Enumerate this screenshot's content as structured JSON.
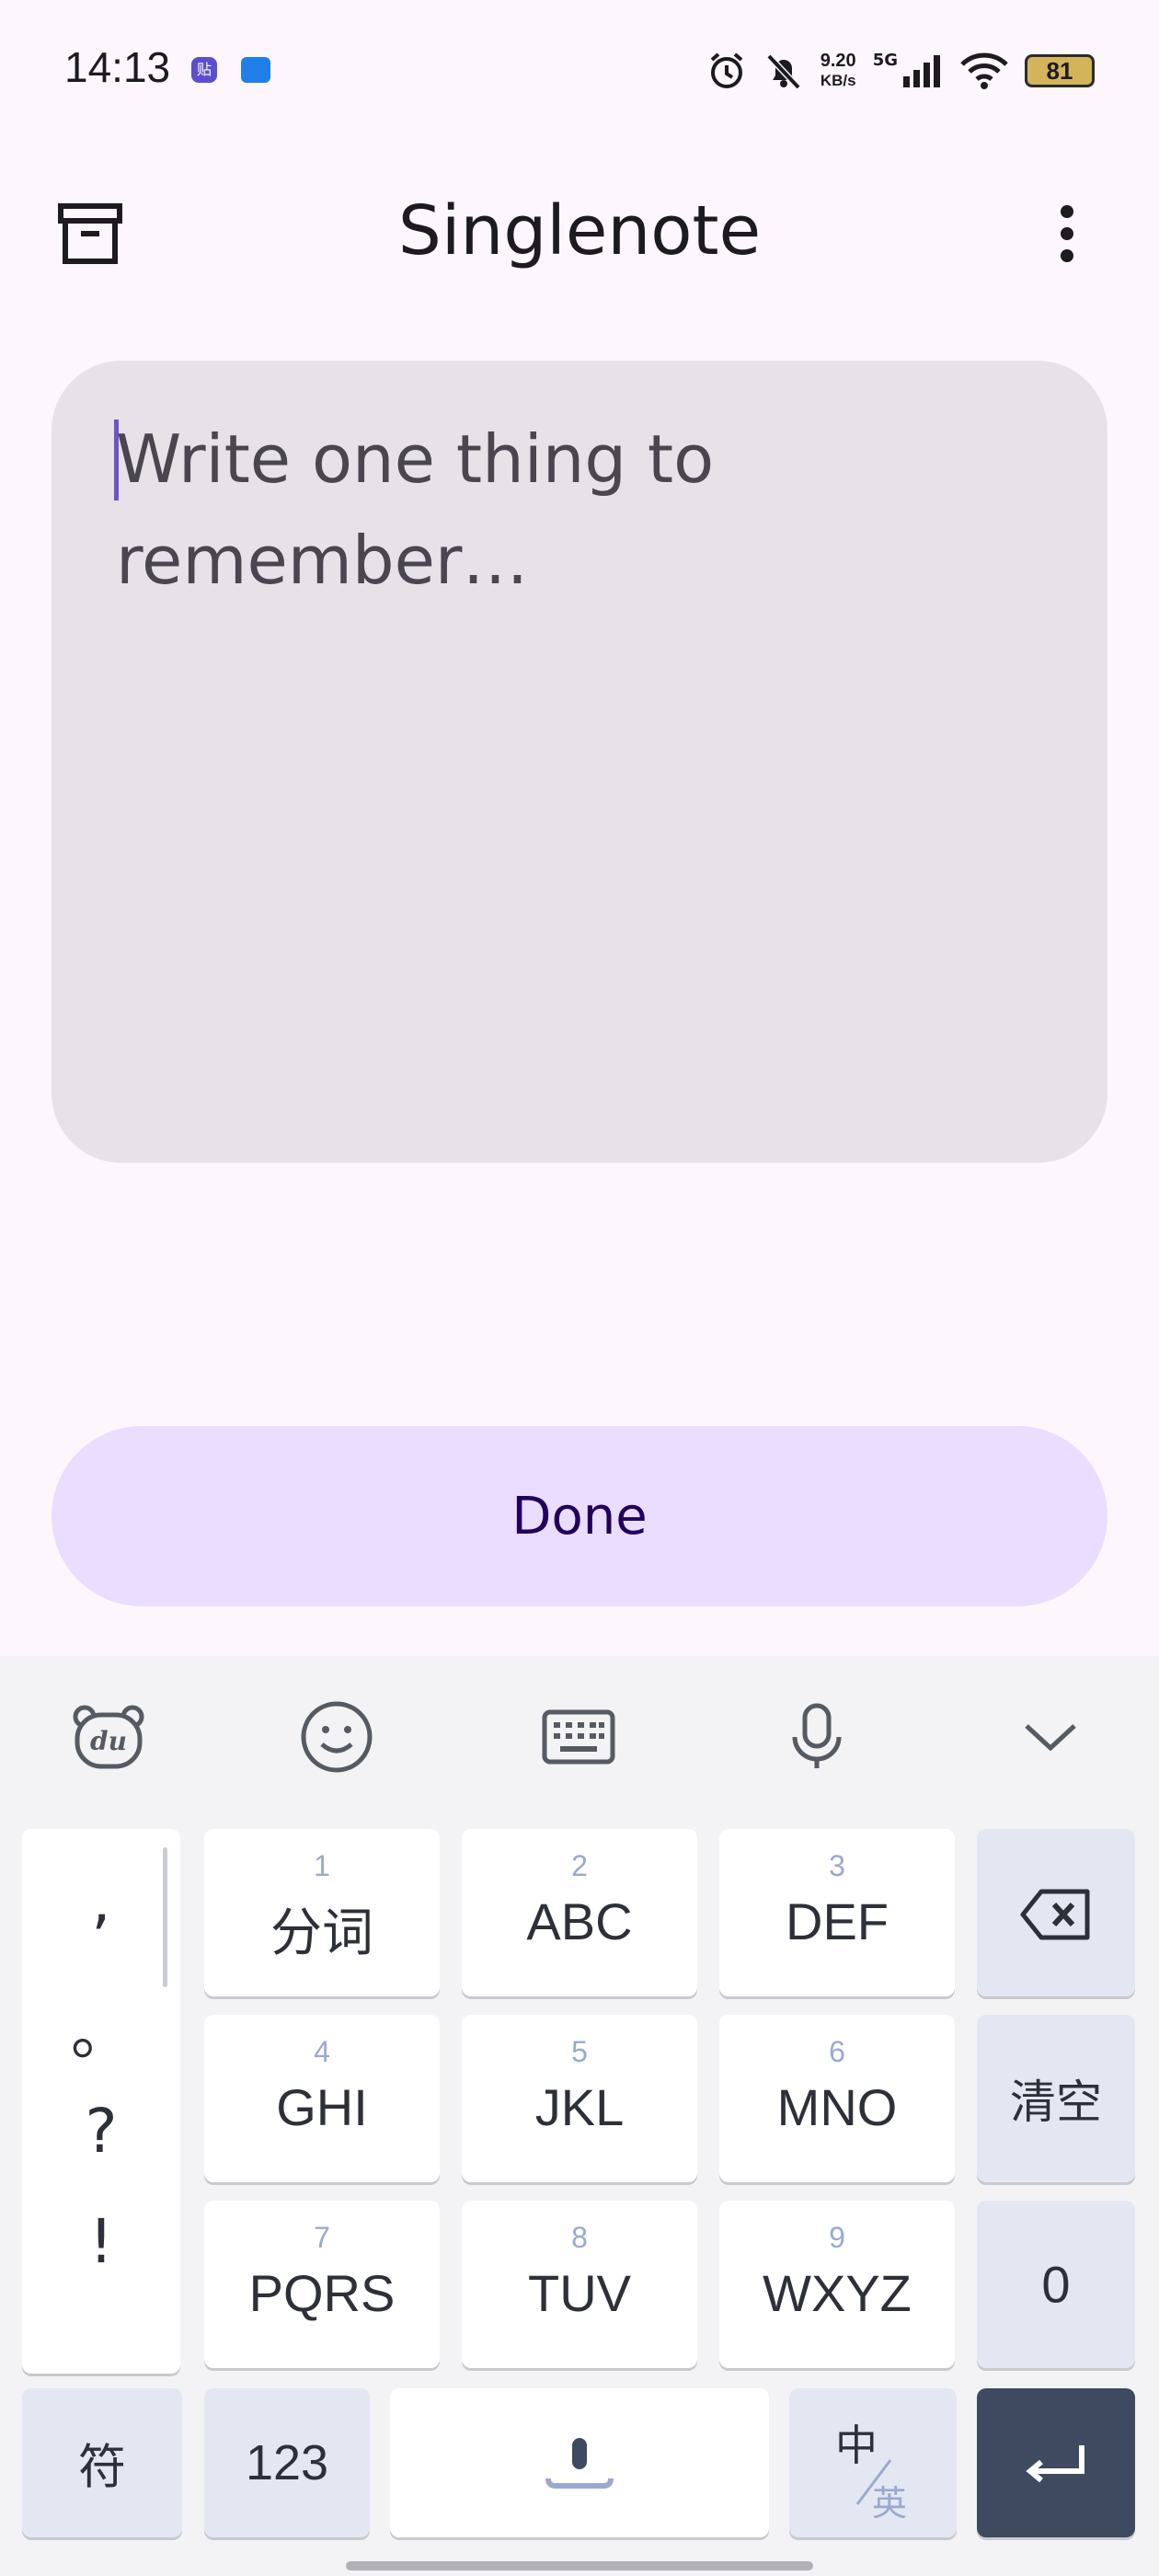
{
  "status_bar": {
    "time": "14:13",
    "notif_badge": "贴",
    "net_speed_value": "9.20",
    "net_speed_unit": "KB/s",
    "signal_label": "5G",
    "battery_level": "81",
    "icons": [
      "alarm-icon",
      "mute-bell-icon",
      "signal-icon",
      "wifi-icon",
      "battery-icon"
    ]
  },
  "app_bar": {
    "title": "Singlenote",
    "left_icon": "archive-icon",
    "right_icon": "more-vert-icon"
  },
  "note_field": {
    "value": "",
    "placeholder": "Write one thing to remember…"
  },
  "done_button": {
    "label": "Done"
  },
  "keyboard": {
    "toolbar_icons": [
      "baidu-du-icon",
      "emoji-icon",
      "keyboard-icon",
      "mic-icon",
      "collapse-icon"
    ],
    "punctuation": [
      ",",
      "。",
      "?",
      "!"
    ],
    "keys": [
      {
        "num": "1",
        "label": "分词"
      },
      {
        "num": "2",
        "label": "ABC"
      },
      {
        "num": "3",
        "label": "DEF"
      },
      {
        "num": "4",
        "label": "GHI"
      },
      {
        "num": "5",
        "label": "JKL"
      },
      {
        "num": "6",
        "label": "MNO"
      },
      {
        "num": "7",
        "label": "PQRS"
      },
      {
        "num": "8",
        "label": "TUV"
      },
      {
        "num": "9",
        "label": "WXYZ"
      }
    ],
    "clear_label": "清空",
    "zero_label": "0",
    "symbols_label": "符",
    "numbers_label": "123",
    "lang_primary": "中",
    "lang_secondary": "英",
    "colors": {
      "accent": "#eaddff",
      "enter_key": "#3d4a60",
      "number_hint": "#9aa9cf"
    }
  }
}
